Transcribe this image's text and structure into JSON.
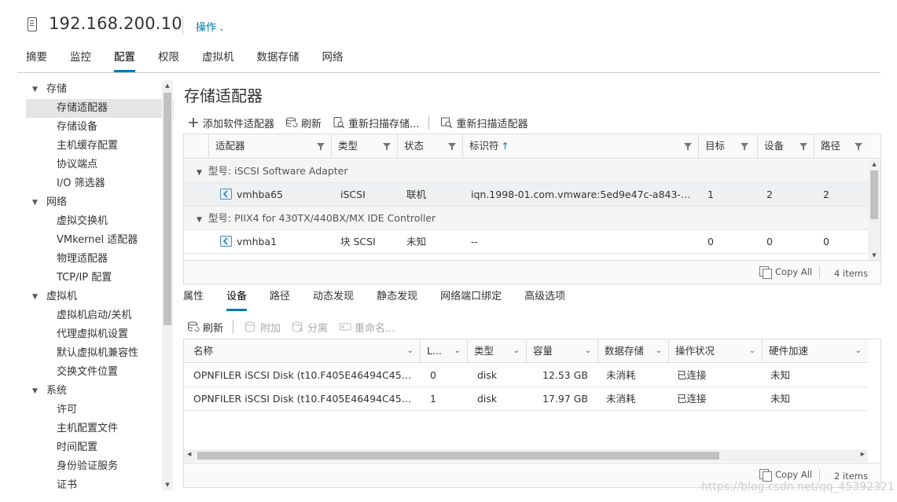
{
  "header": {
    "host": "192.168.200.10",
    "actions_label": "操作"
  },
  "tabs": [
    {
      "label": "摘要"
    },
    {
      "label": "监控"
    },
    {
      "label": "配置",
      "active": true
    },
    {
      "label": "权限"
    },
    {
      "label": "虚拟机"
    },
    {
      "label": "数据存储"
    },
    {
      "label": "网络"
    }
  ],
  "sidebar": {
    "groups": [
      {
        "label": "存储",
        "items": [
          "存储适配器",
          "存储设备",
          "主机缓存配置",
          "协议端点",
          "I/O 筛选器"
        ]
      },
      {
        "label": "网络",
        "items": [
          "虚拟交换机",
          "VMkernel 适配器",
          "物理适配器",
          "TCP/IP 配置"
        ]
      },
      {
        "label": "虚拟机",
        "items": [
          "虚拟机启动/关机",
          "代理虚拟机设置",
          "默认虚拟机兼容性",
          "交换文件位置"
        ]
      },
      {
        "label": "系统",
        "items": [
          "许可",
          "主机配置文件",
          "时间配置",
          "身份验证服务",
          "证书"
        ]
      }
    ],
    "selected": "存储适配器"
  },
  "main": {
    "title": "存储适配器",
    "toolbar": {
      "add": "添加软件适配器",
      "refresh": "刷新",
      "rescan_storage": "重新扫描存储...",
      "rescan_adapter": "重新扫描适配器"
    },
    "adapters_grid": {
      "columns": [
        "适配器",
        "类型",
        "状态",
        "标识符",
        "目标",
        "设备",
        "路径"
      ],
      "group1": "型号: iSCSI Software Adapter",
      "row1": {
        "adapter": "vmhba65",
        "type": "iSCSI",
        "status": "联机",
        "identifier": "iqn.1998-01.com.vmware:5ed9e47c-a843-b849...",
        "targets": "1",
        "devices": "2",
        "paths": "2"
      },
      "group2": "型号: PIIX4 for 430TX/440BX/MX IDE Controller",
      "row2": {
        "adapter": "vmhba1",
        "type": "块 SCSI",
        "status": "未知",
        "identifier": "--",
        "targets": "0",
        "devices": "0",
        "paths": "0"
      },
      "copy_all": "Copy All",
      "count": "4 items"
    },
    "subtabs": [
      {
        "label": "属性"
      },
      {
        "label": "设备",
        "active": true
      },
      {
        "label": "路径"
      },
      {
        "label": "动态发现"
      },
      {
        "label": "静态发现"
      },
      {
        "label": "网络端口绑定"
      },
      {
        "label": "高级选项"
      }
    ],
    "toolbar2": {
      "refresh": "刷新",
      "attach": "附加",
      "detach": "分离",
      "rename": "重命名..."
    },
    "devices_grid": {
      "columns": [
        "名称",
        "L...",
        "类型",
        "容量",
        "数据存储",
        "操作状况",
        "硬件加速"
      ],
      "rows": [
        {
          "name": "OPNFILER iSCSI Disk (t10.F405E46494C45425...",
          "lun": "0",
          "type": "disk",
          "capacity": "12.53 GB",
          "datastore": "未消耗",
          "status": "已连接",
          "hw": "未知"
        },
        {
          "name": "OPNFILER iSCSI Disk (t10.F405E46494C45425...",
          "lun": "1",
          "type": "disk",
          "capacity": "17.97 GB",
          "datastore": "未消耗",
          "status": "已连接",
          "hw": "未知"
        }
      ],
      "copy_all": "Copy All",
      "count": "2 items"
    }
  },
  "watermark": "https://blog.csdn.net/qq_45392321"
}
